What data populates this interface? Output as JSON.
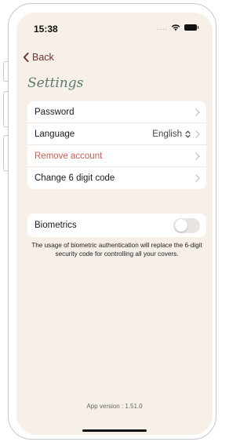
{
  "status": {
    "time": "15:38",
    "cell": "....."
  },
  "nav": {
    "back_label": "Back"
  },
  "page": {
    "title": "Settings"
  },
  "settings": {
    "password": "Password",
    "language": "Language",
    "language_value": "English",
    "remove_account": "Remove account",
    "change_code": "Change 6 digit code"
  },
  "biometrics": {
    "label": "Biometrics",
    "enabled": false,
    "note": "The usage of biometric authentication will replace the 6-digit security code for controlling all your covers."
  },
  "footer": {
    "version": "App version : 1.51.0"
  },
  "colors": {
    "background": "#f6f0e8",
    "accent": "#6b3530",
    "title": "#5e7a73",
    "danger": "#d2594e"
  }
}
